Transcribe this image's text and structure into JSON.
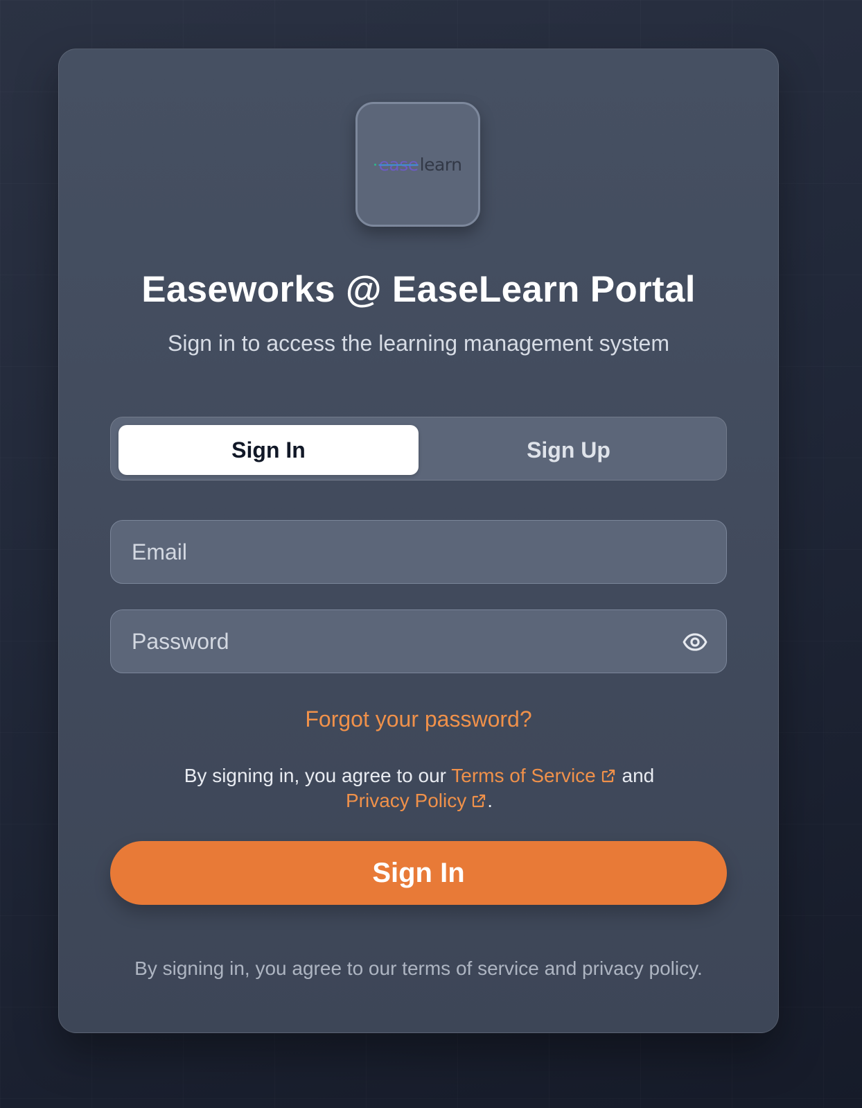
{
  "logo": {
    "prefix_text": "ease",
    "suffix_text": "learn",
    "icon": "easelearn-logo"
  },
  "header": {
    "title": "Easeworks @ EaseLearn Portal",
    "subtitle": "Sign in to access the learning management system"
  },
  "tabs": [
    {
      "label": "Sign In",
      "active": true
    },
    {
      "label": "Sign Up",
      "active": false
    }
  ],
  "form": {
    "email": {
      "value": "",
      "placeholder": "Email"
    },
    "password": {
      "value": "",
      "placeholder": "Password",
      "toggle_icon": "eye-icon"
    },
    "forgot_label": "Forgot your password?",
    "legal": {
      "prefix": "By signing in, you agree to our ",
      "terms_label": "Terms of Service",
      "middle": " and",
      "privacy_label": "Privacy Policy",
      "suffix": ".",
      "link_icon": "external-link-icon"
    },
    "submit_label": "Sign In"
  },
  "footer": {
    "note": "By signing in, you agree to our terms of service and privacy policy."
  },
  "colors": {
    "accent": "#e87a37",
    "link": "#f0914a",
    "card": "#434c5e",
    "field": "#5c6679",
    "background": "#1e2433"
  }
}
